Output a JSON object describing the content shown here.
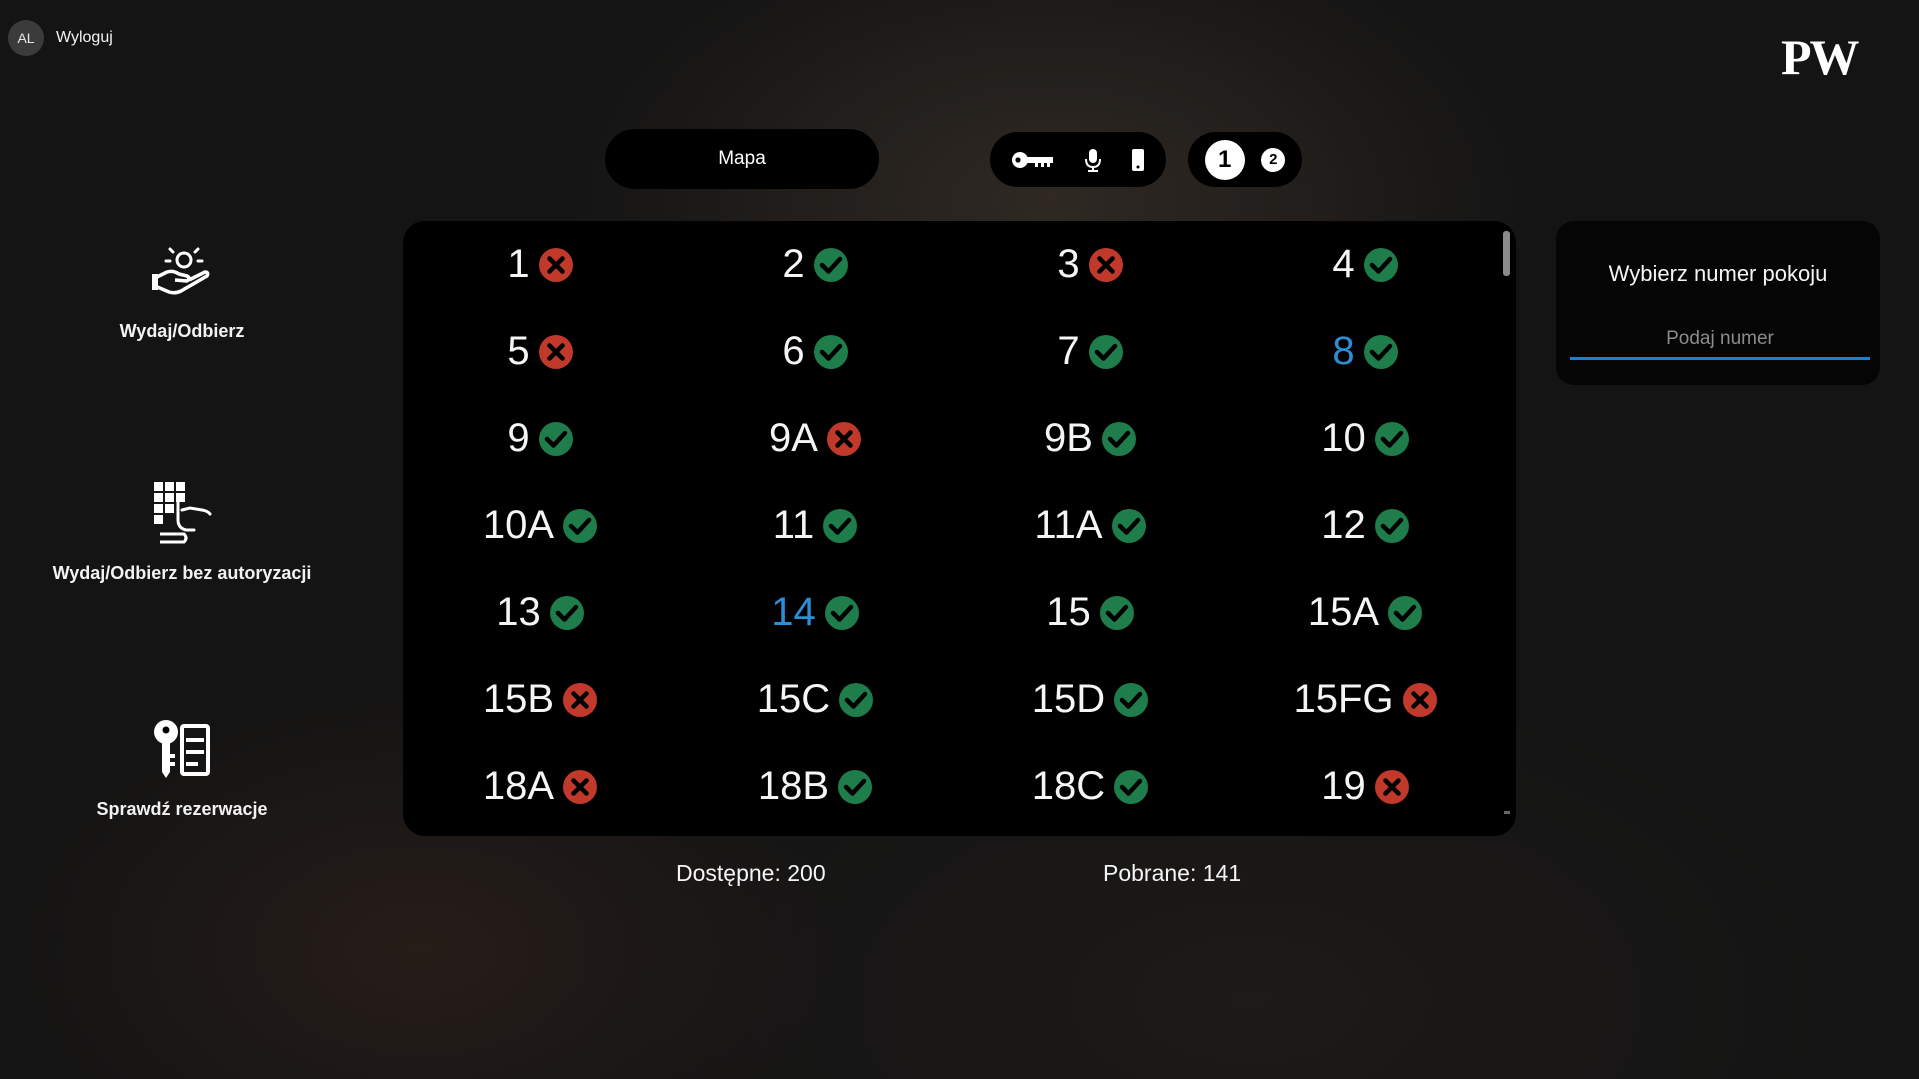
{
  "user": {
    "initials": "AL",
    "logout_label": "Wyloguj"
  },
  "logo": {
    "text": "PW"
  },
  "toolbar": {
    "map_label": "Mapa",
    "modes": [
      "key-icon",
      "microphone-icon",
      "phone-icon"
    ],
    "pages": [
      "1",
      "2"
    ],
    "active_page": "1"
  },
  "sidebar": {
    "items": [
      {
        "label": "Wydaj/Odbierz",
        "icon": "hand-person-icon"
      },
      {
        "label": "Wydaj/Odbierz bez autoryzacji",
        "icon": "keypad-hand-icon"
      },
      {
        "label": "Sprawdź rezerwacje",
        "icon": "key-list-icon"
      }
    ]
  },
  "rooms": [
    {
      "number": "1",
      "available": false
    },
    {
      "number": "2",
      "available": true
    },
    {
      "number": "3",
      "available": false
    },
    {
      "number": "4",
      "available": true
    },
    {
      "number": "5",
      "available": false
    },
    {
      "number": "6",
      "available": true
    },
    {
      "number": "7",
      "available": true
    },
    {
      "number": "8",
      "available": true,
      "highlight": true
    },
    {
      "number": "9",
      "available": true
    },
    {
      "number": "9A",
      "available": false
    },
    {
      "number": "9B",
      "available": true
    },
    {
      "number": "10",
      "available": true
    },
    {
      "number": "10A",
      "available": true
    },
    {
      "number": "11",
      "available": true
    },
    {
      "number": "11A",
      "available": true
    },
    {
      "number": "12",
      "available": true
    },
    {
      "number": "13",
      "available": true
    },
    {
      "number": "14",
      "available": true,
      "highlight": true
    },
    {
      "number": "15",
      "available": true
    },
    {
      "number": "15A",
      "available": true
    },
    {
      "number": "15B",
      "available": false
    },
    {
      "number": "15C",
      "available": true
    },
    {
      "number": "15D",
      "available": true
    },
    {
      "number": "15FG",
      "available": false
    },
    {
      "number": "18A",
      "available": false
    },
    {
      "number": "18B",
      "available": true
    },
    {
      "number": "18C",
      "available": true
    },
    {
      "number": "19",
      "available": false
    }
  ],
  "stats": {
    "available_label": "Dostępne: 200",
    "taken_label": "Pobrane: 141"
  },
  "room_picker": {
    "title": "Wybierz numer pokoju",
    "placeholder": "Podaj numer",
    "value": ""
  },
  "colors": {
    "available": "#1e7d4a",
    "unavailable": "#c0392b",
    "highlight": "#2b8fd6",
    "input_underline": "#1f7fcf"
  }
}
